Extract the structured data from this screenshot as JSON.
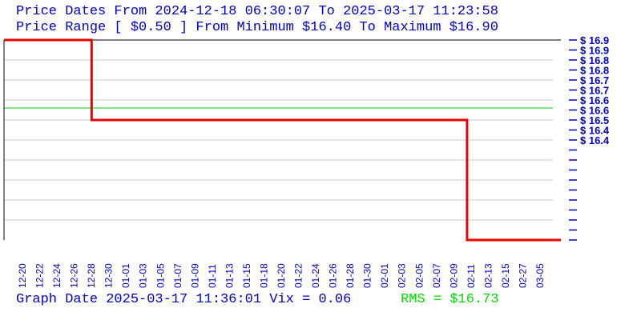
{
  "header": {
    "line1": "Price Dates From 2024-12-18 06:30:07 To 2025-03-17 11:23:58",
    "line2": "Price Range [ $0.50 ] From Minimum $16.40 To Maximum $16.90"
  },
  "footer": {
    "graph_date": "Graph Date 2025-03-17 11:36:01 Vix = 0.06",
    "rms": "RMS = $16.73"
  },
  "colors": {
    "text": "#0000cc",
    "price_line": "#ee0000",
    "rms_line": "#00cc00",
    "grid": "#c8c8c8",
    "axis": "#000000"
  },
  "chart_data": {
    "type": "line",
    "title": "",
    "xlabel": "",
    "ylabel": "",
    "ylim": [
      16.4,
      16.9
    ],
    "grid": true,
    "y_ticks": [
      16.9,
      16.875,
      16.85,
      16.825,
      16.8,
      16.775,
      16.75,
      16.725,
      16.7,
      16.675,
      16.65,
      16.625,
      16.6,
      16.575,
      16.55,
      16.525,
      16.5,
      16.475,
      16.45,
      16.425,
      16.4
    ],
    "y_tick_labels": [
      "$ 16.9",
      "$ 16.9",
      "$ 16.8",
      "$ 16.8",
      "$ 16.7",
      "$ 16.7",
      "$ 16.6",
      "$ 16.6",
      "$ 16.5",
      "$ 16.4",
      "$ 16.4"
    ],
    "x_tick_labels": [
      "12-20",
      "12-22",
      "12-24",
      "12-26",
      "12-28",
      "12-30",
      "01-01",
      "01-03",
      "01-05",
      "01-07",
      "01-09",
      "01-11",
      "01-13",
      "01-15",
      "01-18",
      "01-20",
      "01-22",
      "01-24",
      "01-26",
      "01-28",
      "01-30",
      "02-01",
      "02-03",
      "02-05",
      "02-07",
      "02-09",
      "02-11",
      "02-13",
      "02-15",
      "02-27",
      "03-05"
    ],
    "series": [
      {
        "color": "#ee0000",
        "step": true,
        "points": [
          {
            "x": "2024-12-18",
            "y": 16.9
          },
          {
            "x": "2025-01-01",
            "y": 16.9
          },
          {
            "x": "2025-01-01",
            "y": 16.7
          },
          {
            "x": "2025-03-02",
            "y": 16.7
          },
          {
            "x": "2025-03-02",
            "y": 16.4
          },
          {
            "x": "2025-03-17",
            "y": 16.4
          }
        ]
      }
    ],
    "rms_value": 16.73
  }
}
